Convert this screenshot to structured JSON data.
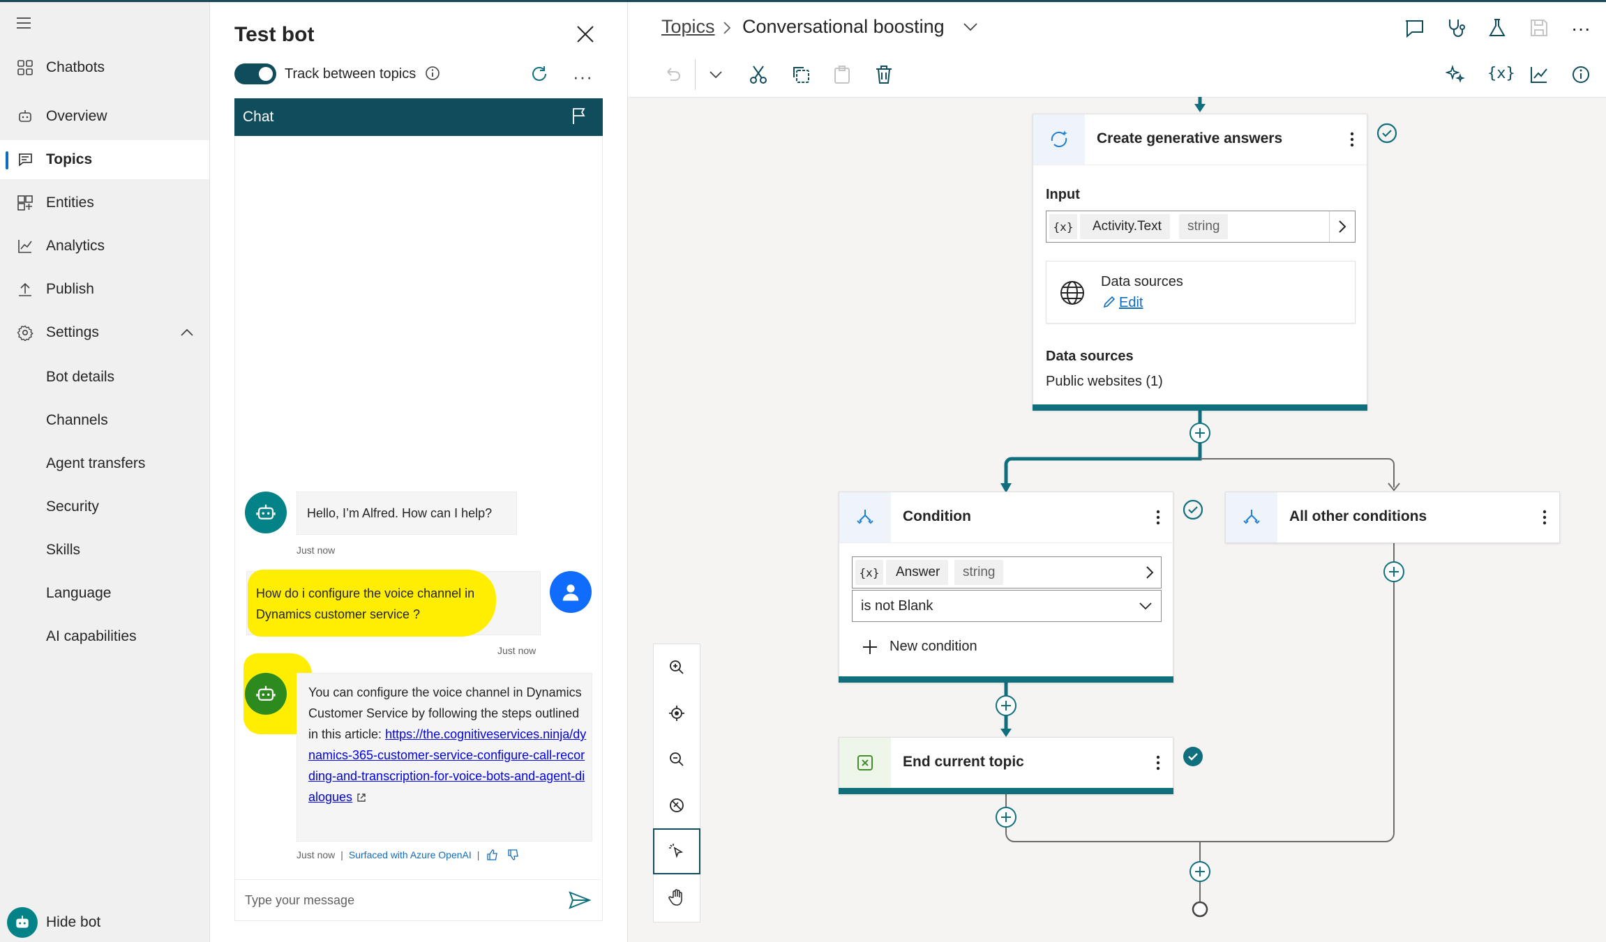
{
  "nav": {
    "items": [
      {
        "label": "Chatbots",
        "icon": "grid-icon"
      },
      {
        "label": "Overview",
        "icon": "bot-icon"
      },
      {
        "label": "Topics",
        "icon": "chat-icon",
        "active": true
      },
      {
        "label": "Entities",
        "icon": "entities-icon"
      },
      {
        "label": "Analytics",
        "icon": "analytics-icon"
      },
      {
        "label": "Publish",
        "icon": "publish-icon"
      },
      {
        "label": "Settings",
        "icon": "gear-icon"
      }
    ],
    "settings_sub": [
      "Bot details",
      "Channels",
      "Agent transfers",
      "Security",
      "Skills",
      "Language",
      "AI capabilities"
    ],
    "hide_bot": "Hide bot"
  },
  "testbot": {
    "title": "Test bot",
    "track_label": "Track between topics",
    "track_on": true,
    "chat_header": "Chat",
    "messages": {
      "greeting": "Hello, I’m Alfred. How can I help?",
      "greeting_time": "Just now",
      "user_q": "How do i configure the voice channel in Dynamics customer service ?",
      "user_time": "Just now",
      "answer": "You can configure the voice channel in Dynamics Customer Service by following the steps outlined in this article:",
      "answer_link": "https://the.cognitiveservices.ninja/dynamics-365-customer-service-configure-call-recording-and-transcription-for-voice-bots-and-agent-dialogues",
      "answer_time": "Just now",
      "answer_source": "Surfaced with Azure OpenAI",
      "separator": "|"
    },
    "input_placeholder": "Type your message"
  },
  "canvas": {
    "breadcrumb_root": "Topics",
    "breadcrumb_current": "Conversational boosting",
    "gen_node": {
      "title": "Create generative answers",
      "input_label": "Input",
      "var_icon": "{x}",
      "var_name": "Activity.Text",
      "var_type": "string",
      "ds_title": "Data sources",
      "ds_edit": "Edit",
      "ds_label": "Data sources",
      "ds_value": "Public websites (1)"
    },
    "condition_node": {
      "title": "Condition",
      "var_icon": "{x}",
      "var_name": "Answer",
      "var_type": "string",
      "operator": "is not Blank",
      "new_condition": "New condition"
    },
    "other_node": {
      "title": "All other conditions"
    },
    "end_node": {
      "title": "End current topic"
    },
    "colors": {
      "accent": "#0f6f7c",
      "header": "#0f4c5c"
    }
  }
}
